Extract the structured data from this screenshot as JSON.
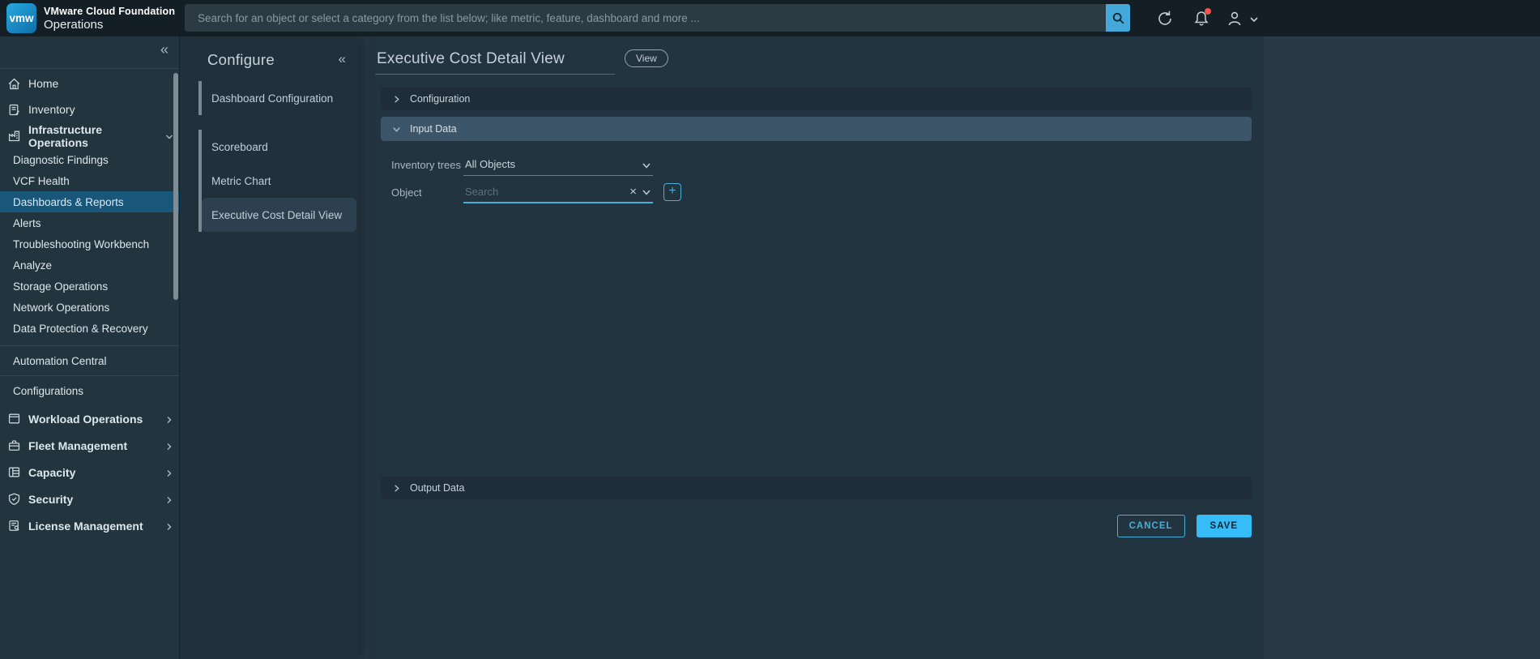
{
  "colors": {
    "accent": "#49AFD9",
    "save_fill": "#36BDF7",
    "selected_nav": "#19577A",
    "notification_dot": "#F5524C",
    "expanded_accordion": "#3D5568"
  },
  "header": {
    "logo_text": "vmw",
    "product_line1": "VMware Cloud Foundation",
    "product_line2": "Operations",
    "search_placeholder": "Search for an object or select a category from the list below; like metric, feature, dashboard and more ...",
    "icons": [
      "search-icon",
      "refresh-icon",
      "bell-icon",
      "user-icon",
      "chevron-down-icon"
    ]
  },
  "sidebar": {
    "collapse_glyph": "«",
    "items": [
      {
        "label": "Home",
        "icon": "home-icon"
      },
      {
        "label": "Inventory",
        "icon": "inventory-icon"
      },
      {
        "label": "Infrastructure Operations",
        "icon": "infrastructure-icon",
        "expanded": true
      },
      {
        "label": "Diagnostic Findings"
      },
      {
        "label": "VCF Health"
      },
      {
        "label": "Dashboards & Reports",
        "selected": true
      },
      {
        "label": "Alerts"
      },
      {
        "label": "Troubleshooting Workbench"
      },
      {
        "label": "Analyze"
      },
      {
        "label": "Storage Operations"
      },
      {
        "label": "Network Operations"
      },
      {
        "label": "Data Protection & Recovery"
      },
      {
        "label": "Automation Central"
      },
      {
        "label": "Configurations"
      },
      {
        "label": "Workload Operations",
        "icon": "workload-icon",
        "collapsed": true
      },
      {
        "label": "Fleet Management",
        "icon": "fleet-icon",
        "collapsed": true
      },
      {
        "label": "Capacity",
        "icon": "capacity-icon",
        "collapsed": true
      },
      {
        "label": "Security",
        "icon": "security-icon",
        "collapsed": true
      },
      {
        "label": "License Management",
        "icon": "license-icon",
        "collapsed": true
      }
    ]
  },
  "configure": {
    "title": "Configure",
    "collapse_glyph": "«",
    "items": [
      {
        "label": "Dashboard Configuration"
      },
      {
        "label": "Scoreboard"
      },
      {
        "label": "Metric Chart"
      },
      {
        "label": "Executive Cost Detail View",
        "selected": true
      }
    ]
  },
  "main": {
    "title": "Executive Cost Detail View",
    "view_button": "View",
    "accordions": {
      "configuration": "Configuration",
      "input_data": "Input Data",
      "output_data": "Output Data"
    },
    "form": {
      "inventory_trees_label": "Inventory trees",
      "inventory_trees_value": "All Objects",
      "object_label": "Object",
      "object_placeholder": "Search",
      "clear_glyph": "×",
      "add_glyph": "+"
    },
    "footer": {
      "cancel": "CANCEL",
      "save": "SAVE"
    }
  }
}
